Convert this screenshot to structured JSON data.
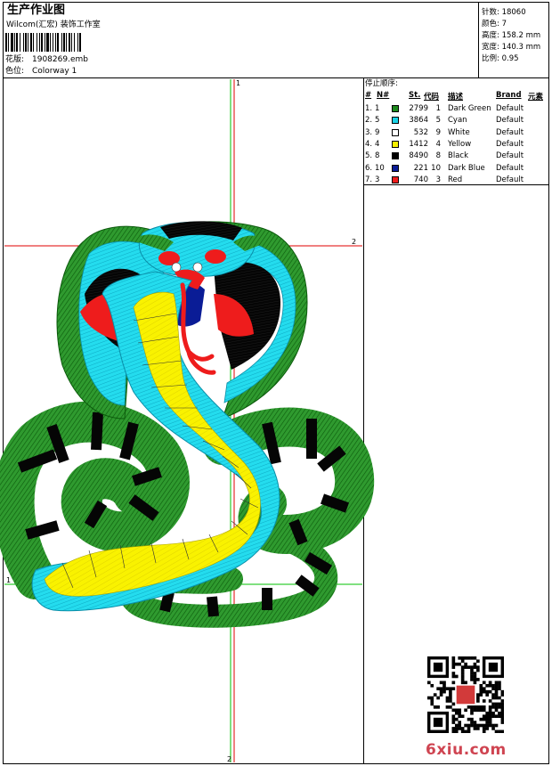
{
  "header": {
    "title": "生产作业图",
    "company": "Wilcom(汇宏) 装饰工作室",
    "design_label": "花版:",
    "design_file": "1908269.emb",
    "colorway_label": "色位:",
    "colorway": "Colorway 1"
  },
  "stats": [
    {
      "label": "针数:",
      "value": "18060"
    },
    {
      "label": "颜色:",
      "value": "7"
    },
    {
      "label": "高度:",
      "value": "158.2 mm"
    },
    {
      "label": "宽度:",
      "value": "140.3 mm"
    },
    {
      "label": "比例:",
      "value": "0.95"
    }
  ],
  "stop_sequence": {
    "title": "停止顺序:",
    "columns": [
      "#",
      "N#",
      "St.",
      "代码",
      "描述",
      "Brand",
      "元素"
    ],
    "rows": [
      {
        "num": "1.",
        "n": "1",
        "st": "2799",
        "code": "1",
        "desc": "Dark Green",
        "brand": "Default",
        "color": "#1e8a1e"
      },
      {
        "num": "2.",
        "n": "5",
        "st": "3864",
        "code": "5",
        "desc": "Cyan",
        "brand": "Default",
        "color": "#1ad2e6"
      },
      {
        "num": "3.",
        "n": "9",
        "st": "532",
        "code": "9",
        "desc": "White",
        "brand": "Default",
        "color": "#ffffff"
      },
      {
        "num": "4.",
        "n": "4",
        "st": "1412",
        "code": "4",
        "desc": "Yellow",
        "brand": "Default",
        "color": "#f7f000"
      },
      {
        "num": "5.",
        "n": "8",
        "st": "8490",
        "code": "8",
        "desc": "Black",
        "brand": "Default",
        "color": "#000000"
      },
      {
        "num": "6.",
        "n": "10",
        "st": "221",
        "code": "10",
        "desc": "Dark Blue",
        "brand": "Default",
        "color": "#0a1c96"
      },
      {
        "num": "7.",
        "n": "3",
        "st": "740",
        "code": "3",
        "desc": "Red",
        "brand": "Default",
        "color": "#ee1c1c"
      }
    ]
  },
  "guides": {
    "top": "1",
    "right": "2",
    "left": "1",
    "bottom": "2"
  },
  "watermark": {
    "text": "6xiu.com",
    "qr_stamp": "刺绣"
  }
}
